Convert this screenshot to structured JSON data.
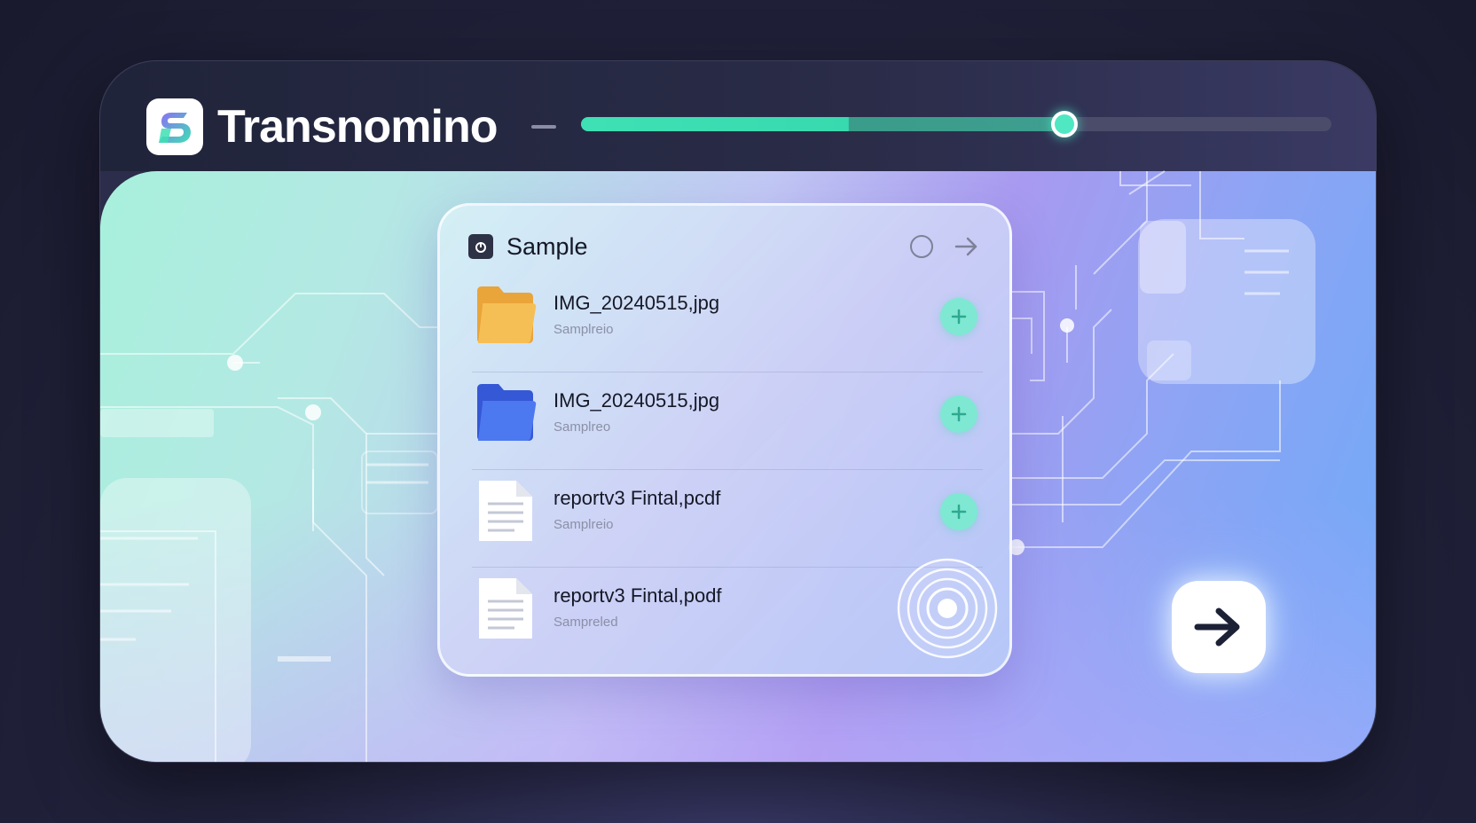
{
  "app": {
    "title": "Transnomino"
  },
  "progress": {
    "value": 0.644,
    "filled": 0.356
  },
  "panel": {
    "title": "Sample",
    "files": [
      {
        "name": "IMG_20240515,jpg",
        "sub": "Samplreio",
        "icon": "folder-orange-icon"
      },
      {
        "name": "IMG_20240515,jpg",
        "sub": "Samplreo",
        "icon": "folder-blue-icon"
      },
      {
        "name": "reportv3 Fintal,pcdf",
        "sub": "Samplreio",
        "icon": "document-icon"
      },
      {
        "name": "reportv3 Fintal,podf",
        "sub": "Sampreled",
        "icon": "document-icon"
      }
    ]
  },
  "colors": {
    "accent": "#4fe8c3",
    "folder_orange": "#f6bf55",
    "folder_blue": "#4c78f0",
    "add_button": "#7ee8d2"
  }
}
